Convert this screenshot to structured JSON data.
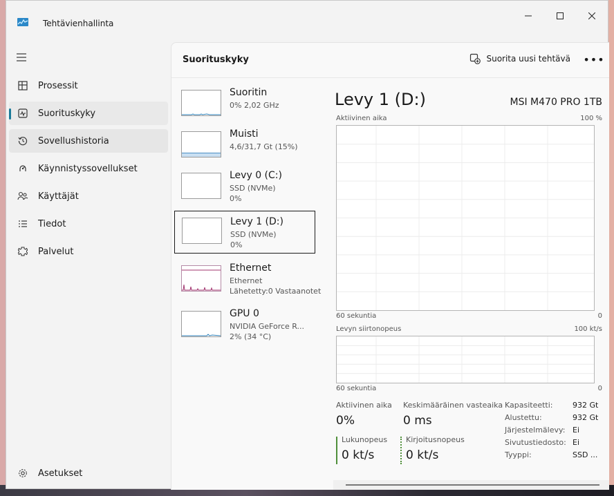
{
  "window": {
    "title": "Tehtävienhallinta",
    "accent_color": "#1a7a99"
  },
  "sidebar": {
    "items": [
      {
        "label": "Prosessit",
        "icon": "processes-icon"
      },
      {
        "label": "Suorituskyky",
        "icon": "performance-icon",
        "selected": true
      },
      {
        "label": "Sovellushistoria",
        "icon": "history-icon",
        "hovered": true
      },
      {
        "label": "Käynnistyssovellukset",
        "icon": "startup-icon"
      },
      {
        "label": "Käyttäjät",
        "icon": "users-icon"
      },
      {
        "label": "Tiedot",
        "icon": "details-icon"
      },
      {
        "label": "Palvelut",
        "icon": "services-icon"
      }
    ],
    "settings_label": "Asetukset"
  },
  "header": {
    "title": "Suorituskyky",
    "run_task_label": "Suorita uusi tehtävä",
    "more_label": "•••"
  },
  "devices": [
    {
      "name": "Suoritin",
      "line1": "0% 2,02 GHz",
      "line2": ""
    },
    {
      "name": "Muisti",
      "line1": "4,6/31,7 Gt (15%)",
      "line2": "",
      "usage_fraction": 0.15
    },
    {
      "name": "Levy 0 (C:)",
      "line1": "SSD (NVMe)",
      "line2": "0%"
    },
    {
      "name": "Levy 1 (D:)",
      "line1": "SSD (NVMe)",
      "line2": "0%",
      "selected": true
    },
    {
      "name": "Ethernet",
      "line1": "Ethernet",
      "line2": "Lähetetty:0 Vastaanotet"
    },
    {
      "name": "GPU 0",
      "line1": "NVIDIA GeForce R...",
      "line2": "2% (34 °C)"
    }
  ],
  "detail": {
    "title": "Levy 1 (D:)",
    "model": "MSI M470 PRO 1TB",
    "active_time_chart": {
      "label": "Aktiivinen aika",
      "max_label": "100 %",
      "time_label": "60 sekuntia",
      "min_label": "0"
    },
    "transfer_chart": {
      "label": "Levyn siirtonopeus",
      "max_label": "100 kt/s",
      "time_label": "60 sekuntia",
      "min_label": "0"
    },
    "stats": {
      "active_time_label": "Aktiivinen aika",
      "active_time_value": "0%",
      "avg_response_label": "Keskimääräinen vasteaika",
      "avg_response_value": "0 ms",
      "read_label": "Lukunopeus",
      "read_value": "0 kt/s",
      "write_label": "Kirjoitusnopeus",
      "write_value": "0 kt/s"
    },
    "properties": [
      {
        "label": "Kapasiteetti:",
        "value": "932 Gt"
      },
      {
        "label": "Alustettu:",
        "value": "932 Gt"
      },
      {
        "label": "Järjestelmälevy:",
        "value": "Ei"
      },
      {
        "label": "Sivutustiedosto:",
        "value": "Ei"
      },
      {
        "label": "Tyyppi:",
        "value": "SSD ..."
      }
    ]
  }
}
